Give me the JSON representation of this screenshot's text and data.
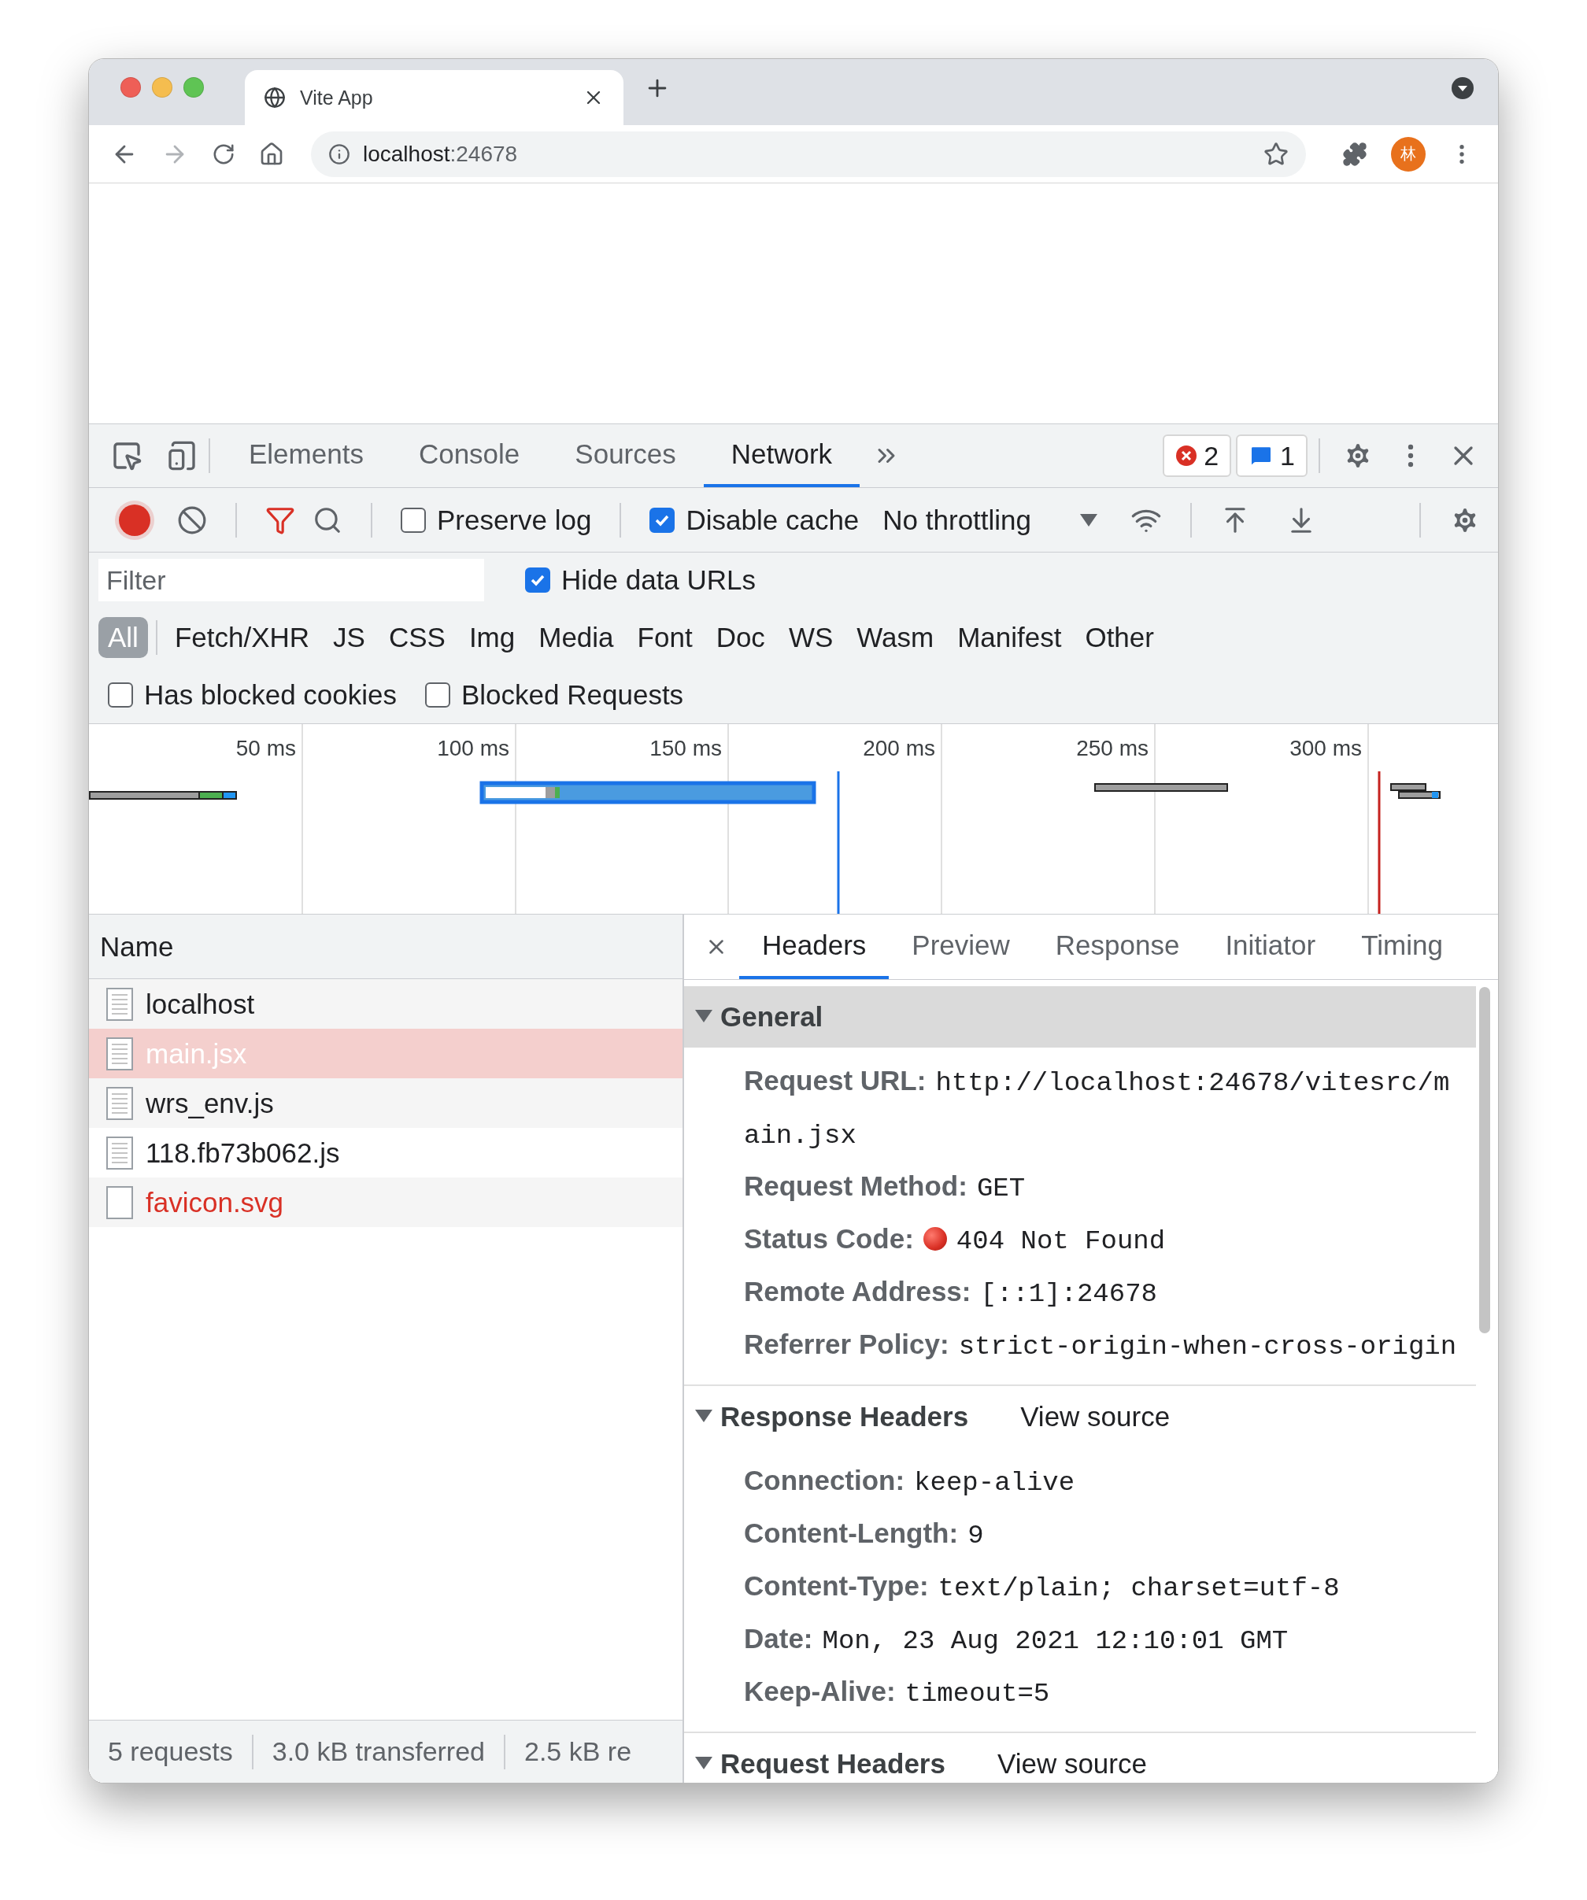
{
  "browser": {
    "tab_title": "Vite App",
    "url_host": "localhost",
    "url_port": ":24678",
    "profile_initial": "林"
  },
  "devtools": {
    "panel_tabs": [
      {
        "label": "Elements",
        "selected": false
      },
      {
        "label": "Console",
        "selected": false
      },
      {
        "label": "Sources",
        "selected": false
      },
      {
        "label": "Network",
        "selected": true
      }
    ],
    "error_count": "2",
    "message_count": "1",
    "network_toolbar": {
      "recording": true,
      "preserve_log": {
        "label": "Preserve log",
        "checked": false
      },
      "disable_cache": {
        "label": "Disable cache",
        "checked": true
      },
      "throttling": "No throttling"
    },
    "filter": {
      "placeholder": "Filter",
      "hide_data_urls": {
        "label": "Hide data URLs",
        "checked": true
      }
    },
    "type_filters": [
      {
        "label": "All",
        "selected": true
      },
      {
        "label": "Fetch/XHR",
        "selected": false
      },
      {
        "label": "JS",
        "selected": false
      },
      {
        "label": "CSS",
        "selected": false
      },
      {
        "label": "Img",
        "selected": false
      },
      {
        "label": "Media",
        "selected": false
      },
      {
        "label": "Font",
        "selected": false
      },
      {
        "label": "Doc",
        "selected": false
      },
      {
        "label": "WS",
        "selected": false
      },
      {
        "label": "Wasm",
        "selected": false
      },
      {
        "label": "Manifest",
        "selected": false
      },
      {
        "label": "Other",
        "selected": false
      }
    ],
    "blocked_filters": [
      {
        "label": "Has blocked cookies",
        "checked": false
      },
      {
        "label": "Blocked Requests",
        "checked": false
      }
    ],
    "overview_ticks": [
      "50 ms",
      "100 ms",
      "150 ms",
      "200 ms",
      "250 ms",
      "300 ms"
    ],
    "requests_column": "Name",
    "requests": [
      {
        "name": "localhost",
        "kind": "document",
        "error": false,
        "selected": false
      },
      {
        "name": "main.jsx",
        "kind": "document",
        "error": true,
        "selected": true
      },
      {
        "name": "wrs_env.js",
        "kind": "document",
        "error": false,
        "selected": false
      },
      {
        "name": "118.fb73b062.js",
        "kind": "document",
        "error": false,
        "selected": false
      },
      {
        "name": "favicon.svg",
        "kind": "image",
        "error": true,
        "selected": false
      }
    ],
    "status_bar": [
      "5 requests",
      "3.0 kB transferred",
      "2.5 kB re"
    ],
    "detail_tabs": [
      {
        "label": "Headers",
        "selected": true
      },
      {
        "label": "Preview",
        "selected": false
      },
      {
        "label": "Response",
        "selected": false
      },
      {
        "label": "Initiator",
        "selected": false
      },
      {
        "label": "Timing",
        "selected": false
      }
    ],
    "sections": [
      {
        "title": "General",
        "expanded": true,
        "focused": true,
        "fields": [
          {
            "name": "Request URL:",
            "value": "http://localhost:24678/vitesrc/main.jsx",
            "kind": "plain"
          },
          {
            "name": "Request Method:",
            "value": "GET",
            "kind": "plain"
          },
          {
            "name": "Status Code:",
            "value": "404 Not Found",
            "kind": "status"
          },
          {
            "name": "Remote Address:",
            "value": "[::1]:24678",
            "kind": "plain"
          },
          {
            "name": "Referrer Policy:",
            "value": "strict-origin-when-cross-origin",
            "kind": "plain"
          }
        ]
      },
      {
        "title": "Response Headers",
        "expanded": true,
        "focused": false,
        "view_source": "View source",
        "fields": [
          {
            "name": "Connection:",
            "value": "keep-alive",
            "kind": "plain"
          },
          {
            "name": "Content-Length:",
            "value": "9",
            "kind": "plain"
          },
          {
            "name": "Content-Type:",
            "value": "text/plain; charset=utf-8",
            "kind": "plain"
          },
          {
            "name": "Date:",
            "value": "Mon, 23 Aug 2021 12:10:01 GMT",
            "kind": "plain"
          },
          {
            "name": "Keep-Alive:",
            "value": "timeout=5",
            "kind": "plain"
          }
        ]
      },
      {
        "title": "Request Headers",
        "expanded": true,
        "focused": false,
        "view_source": "View source"
      }
    ]
  }
}
